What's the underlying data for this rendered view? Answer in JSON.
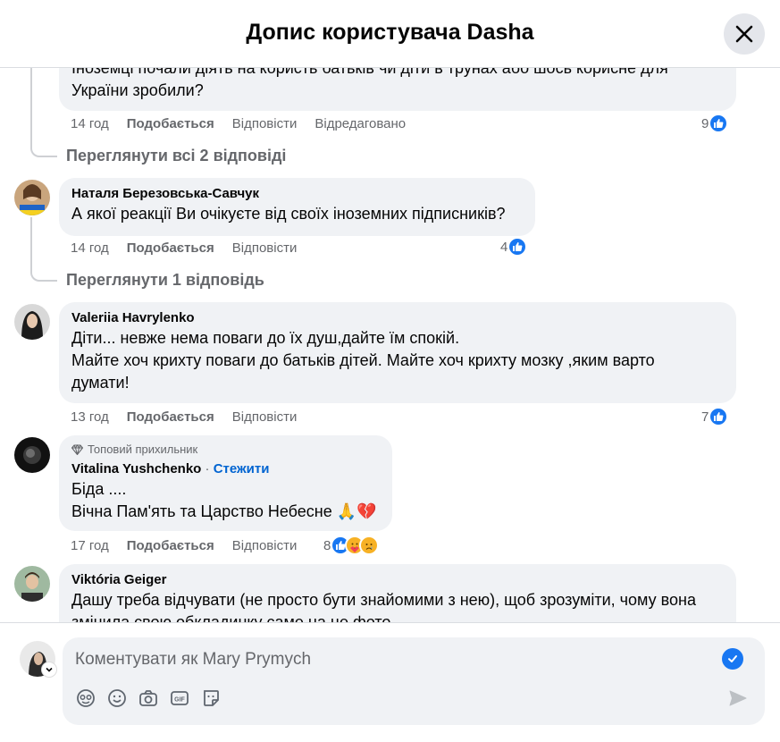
{
  "header": {
    "title": "Допис користувача Dasha",
    "close_icon": "close-icon"
  },
  "partial_comment": {
    "text_line1": "Іноземці почали діять на користь батьків чи діти в трунах або шось корисне для",
    "text_line2": "України зробили?",
    "time": "14 год",
    "like_label": "Подобається",
    "reply_label": "Відповісти",
    "edited_label": "Відредаговано",
    "reactions_count": "9"
  },
  "view_replies_1": "Переглянути всі 2 відповіді",
  "comment_1": {
    "author": "Наталя Березовська-Савчук",
    "text": "А якої реакції Ви очікуєте від своїх іноземних підписників?",
    "time": "14 год",
    "like_label": "Подобається",
    "reply_label": "Відповісти",
    "reactions_count": "4"
  },
  "view_replies_2": "Переглянути 1 відповідь",
  "comment_2": {
    "author": "Valeriia Havrylenko",
    "text_line1": "Діти... невже нема поваги до їх душ,дайте їм спокій.",
    "text_line2": "Майте хоч крихту поваги до батьків дітей. Майте хоч крихту мозку ,яким варто",
    "text_line3": "думати!",
    "time": "13 год",
    "like_label": "Подобається",
    "reply_label": "Відповісти",
    "reactions_count": "7"
  },
  "comment_3": {
    "badge": "Топовий прихильник",
    "author": "Vitalina Yushchenko",
    "separator": "·",
    "follow_label": "Стежити",
    "text_line1": "Біда ....",
    "text_line2": "Вічна Пам'ять та Царство Небесне 🙏💔",
    "time": "17 год",
    "like_label": "Подобається",
    "reply_label": "Відповісти",
    "reactions_count": "8"
  },
  "comment_4": {
    "author": "Viktória Geiger",
    "text_line1": "Дашу треба відчувати (не просто бути знайомими з нею), щоб зрозуміти, чому вона",
    "text_line2": "змінила свою обкладинку саме на це фото..."
  },
  "composer": {
    "placeholder": "Коментувати як Mary Prymych",
    "tools": [
      "avatar-sticker-icon",
      "emoji-icon",
      "camera-icon",
      "gif-icon",
      "sticker-icon"
    ],
    "send_icon": "send-icon"
  },
  "colors": {
    "accent": "#1877f2",
    "link": "#0064d1",
    "muted": "#65676b",
    "bubble": "#f0f2f5"
  }
}
